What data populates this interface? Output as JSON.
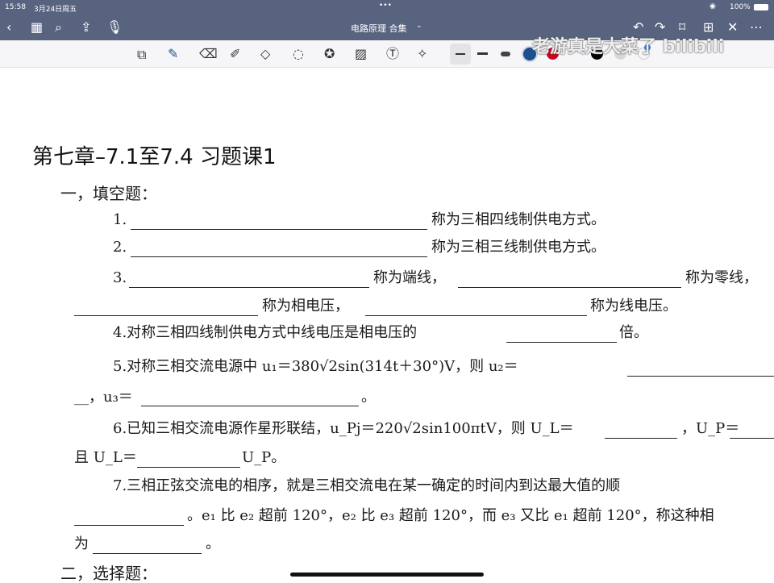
{
  "status": {
    "time": "15:58",
    "date": "3月24日周五",
    "battery": "100%"
  },
  "nav": {
    "title": "电路原理 合集",
    "watermark": "老游真是大菜了 bilibili"
  },
  "toolbar": {
    "colors": [
      "#1f4f8f",
      "#d0021b",
      "#000000",
      "#d8d8d8"
    ]
  },
  "doc": {
    "title": "第七章–7.1至7.4 习题课1",
    "section1": "一，填空题：",
    "q1n": "1.",
    "q1t": "称为三相四线制供电方式。",
    "q2n": "2.",
    "q2t": "称为三相三线制供电方式。",
    "q3n": "3.",
    "q3a": "称为端线，",
    "q3b": "称为零线，",
    "q3c": "称为相电压，",
    "q3d": "称为线电压。",
    "q4a": "4.对称三相四线制供电方式中线电压是相电压的",
    "q4b": "倍。",
    "q5a": "5.对称三相交流电源中 u₁＝380√2sin(314t＋30°)V，则 u₂＝",
    "q5b": "__，u₃＝",
    "q5c": "。",
    "q6a": "6.已知三相交流电源作星形联结，u_Pj＝220√2sin100πtV，则 U_L＝",
    "q6b": "，U_P＝",
    "q6c": "且 U_L＝",
    "q6d": "U_P。",
    "q7a": "7.三相正弦交流电的相序，就是三相交流电在某一确定的时间内到达最大值的顺",
    "q7b": "。e₁ 比 e₂ 超前 120°，e₂ 比 e₃ 超前 120°，而 e₃ 又比 e₁ 超前 120°，称这种相",
    "q7c": "为",
    "q7d": "。",
    "section2": "二，选择题："
  }
}
